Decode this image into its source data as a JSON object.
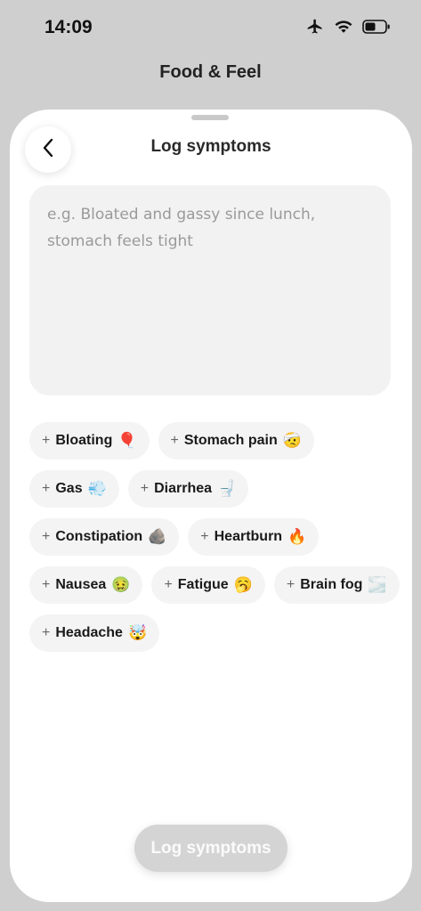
{
  "status": {
    "time": "14:09"
  },
  "app": {
    "title": "Food & Feel"
  },
  "sheet": {
    "title": "Log symptoms",
    "input": {
      "value": "",
      "placeholder": "e.g. Bloated and gassy since lunch, stomach feels tight"
    },
    "chips": [
      {
        "label": "Bloating",
        "emoji": "🎈"
      },
      {
        "label": "Stomach pain",
        "emoji": "🤕"
      },
      {
        "label": "Gas",
        "emoji": "💨"
      },
      {
        "label": "Diarrhea",
        "emoji": "🚽"
      },
      {
        "label": "Constipation",
        "emoji": "🪨"
      },
      {
        "label": "Heartburn",
        "emoji": "🔥"
      },
      {
        "label": "Nausea",
        "emoji": "🤢"
      },
      {
        "label": "Fatigue",
        "emoji": "🥱"
      },
      {
        "label": "Brain fog",
        "emoji": "🌫️"
      },
      {
        "label": "Headache",
        "emoji": "🤯"
      }
    ],
    "submit_label": "Log symptoms"
  },
  "icons": {
    "status": [
      "airplane-icon",
      "wifi-icon",
      "battery-icon"
    ],
    "back": "chevron-left-icon",
    "chip_add": "plus-icon"
  }
}
